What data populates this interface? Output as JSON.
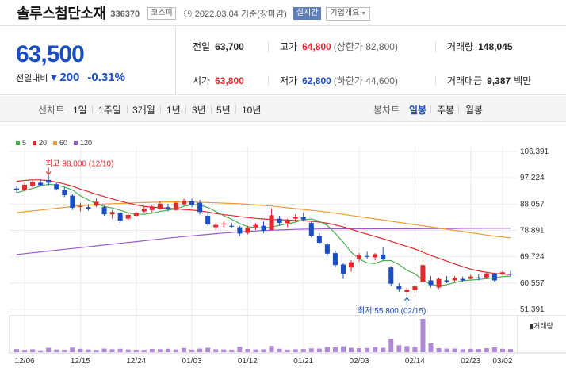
{
  "header": {
    "name": "솔루스첨단소재",
    "code": "336370",
    "market": "코스피",
    "date": "2022.03.04 기준(장마감)",
    "live": "실시간",
    "corp": "기업개요"
  },
  "price": {
    "current": "63,500",
    "change_label": "전일대비",
    "change_amount": "200",
    "change_pct": "-0.31%",
    "direction_symbol": "▼"
  },
  "quote": {
    "prev": {
      "k": "전일",
      "v": "63,700"
    },
    "high": {
      "k": "고가",
      "v": "64,800",
      "s": "(상한가 82,800)"
    },
    "volume": {
      "k": "거래량",
      "v": "148,045"
    },
    "open": {
      "k": "시가",
      "v": "63,800"
    },
    "low": {
      "k": "저가",
      "v": "62,800",
      "s": "(하한가 44,600)"
    },
    "amount": {
      "k": "거래대금",
      "v": "9,387",
      "unit": "백만"
    }
  },
  "periods": {
    "label": "선차트",
    "items": [
      "1일",
      "1주일",
      "3개월",
      "1년",
      "3년",
      "5년",
      "10년"
    ],
    "candle_label": "봉차트",
    "candle_items": [
      "일봉",
      "주봉",
      "월봉"
    ],
    "selected": "일봉"
  },
  "colors": {
    "up": "#e0282d",
    "down": "#1a4ec4",
    "ma5": "#4caf50",
    "ma20": "#e0282d",
    "ma60": "#f29a2e",
    "ma120": "#9b59d0"
  },
  "chart_data": {
    "type": "candlestick",
    "legend": [
      {
        "name": "5",
        "color": "#4caf50"
      },
      {
        "name": "20",
        "color": "#e0282d"
      },
      {
        "name": "60",
        "color": "#f29a2e"
      },
      {
        "name": "120",
        "color": "#9b59d0"
      }
    ],
    "y_ticks": [
      "106,391",
      "97,224",
      "88,057",
      "78,891",
      "69,724",
      "60,557",
      "51,391"
    ],
    "ylim": [
      51391,
      106391
    ],
    "x_ticks": [
      "12/06",
      "12/15",
      "12/24",
      "01/03",
      "01/12",
      "01/21",
      "02/03",
      "02/14",
      "02/23",
      "03/02"
    ],
    "x_tick_index": [
      1,
      8,
      15,
      22,
      29,
      36,
      43,
      50,
      57,
      61
    ],
    "max_label": "최고 98,000 (12/10)",
    "min_label": "최저 55,800 (02/15)",
    "volume_label": "거래량",
    "candles": [
      [
        93500,
        94500,
        92000,
        93000
      ],
      [
        93000,
        95500,
        92500,
        94800
      ],
      [
        94500,
        96500,
        93800,
        95800
      ],
      [
        95500,
        96800,
        94200,
        94600
      ],
      [
        96500,
        98000,
        94500,
        95500
      ],
      [
        95000,
        95500,
        92800,
        93300
      ],
      [
        93000,
        94000,
        90500,
        91200
      ],
      [
        91000,
        91500,
        86000,
        86800
      ],
      [
        87000,
        88500,
        85500,
        87300
      ],
      [
        87000,
        88000,
        85800,
        86500
      ],
      [
        87500,
        90000,
        87000,
        88900
      ],
      [
        87000,
        87500,
        84000,
        84500
      ],
      [
        84500,
        86000,
        83000,
        85300
      ],
      [
        85000,
        85500,
        81500,
        82300
      ],
      [
        83000,
        85000,
        82500,
        84300
      ],
      [
        84000,
        85500,
        83500,
        85000
      ],
      [
        85500,
        87500,
        85000,
        86500
      ],
      [
        86000,
        87800,
        85000,
        87200
      ],
      [
        86500,
        89000,
        86000,
        88200
      ],
      [
        87000,
        88200,
        85500,
        86500
      ],
      [
        86000,
        88800,
        85800,
        88500
      ],
      [
        88000,
        90000,
        87500,
        89300
      ],
      [
        89000,
        90000,
        87000,
        87800
      ],
      [
        88500,
        89500,
        84500,
        85300
      ],
      [
        84000,
        85000,
        80500,
        81000
      ],
      [
        80000,
        81500,
        79000,
        80800
      ],
      [
        81000,
        82000,
        80000,
        81300
      ],
      [
        80500,
        81500,
        79800,
        80200
      ],
      [
        80000,
        80500,
        77000,
        77800
      ],
      [
        78000,
        80500,
        77500,
        79900
      ],
      [
        80000,
        81500,
        79000,
        80800
      ],
      [
        80500,
        82000,
        78000,
        78800
      ],
      [
        79000,
        86500,
        79000,
        84200
      ],
      [
        83000,
        84000,
        80500,
        81500
      ],
      [
        81500,
        83000,
        80000,
        82600
      ],
      [
        83000,
        84500,
        82000,
        83500
      ],
      [
        83500,
        85000,
        82000,
        82700
      ],
      [
        81500,
        82000,
        76500,
        77000
      ],
      [
        77000,
        78000,
        74000,
        74600
      ],
      [
        74000,
        74500,
        70000,
        70800
      ],
      [
        71000,
        72000,
        66000,
        66800
      ],
      [
        67000,
        67500,
        62000,
        63800
      ],
      [
        66000,
        68500,
        64500,
        67800
      ],
      [
        69000,
        71000,
        68000,
        70200
      ],
      [
        70000,
        71500,
        69000,
        69700
      ],
      [
        69500,
        71000,
        68500,
        70600
      ],
      [
        70500,
        73000,
        68500,
        68800
      ],
      [
        66000,
        66500,
        59500,
        60300
      ],
      [
        59500,
        60500,
        57500,
        58500
      ],
      [
        57500,
        59000,
        55800,
        58300
      ],
      [
        58000,
        60000,
        57000,
        59500
      ],
      [
        61000,
        73500,
        60500,
        66800
      ],
      [
        61500,
        63000,
        59000,
        59800
      ],
      [
        59000,
        62500,
        58500,
        62000
      ],
      [
        61500,
        63000,
        60500,
        61000
      ],
      [
        61500,
        63000,
        60800,
        62400
      ],
      [
        62000,
        62800,
        61000,
        61500
      ],
      [
        62000,
        63500,
        61800,
        62800
      ],
      [
        62500,
        63500,
        61500,
        62300
      ],
      [
        62500,
        64500,
        62000,
        63900
      ],
      [
        63800,
        64200,
        61000,
        61500
      ],
      [
        63600,
        64800,
        63200,
        64300
      ],
      [
        63800,
        64800,
        62800,
        63500
      ]
    ],
    "ma5": [
      92000,
      92800,
      93500,
      94300,
      95000,
      94700,
      94000,
      93000,
      91000,
      89500,
      88200,
      87200,
      86700,
      85900,
      85000,
      84600,
      84500,
      84900,
      85500,
      86000,
      86400,
      87300,
      87900,
      87700,
      86900,
      85500,
      84000,
      82800,
      81300,
      80200,
      79800,
      79800,
      80000,
      80700,
      81200,
      81800,
      82600,
      82900,
      82100,
      80600,
      77900,
      74800,
      71300,
      69000,
      67600,
      67400,
      68400,
      68400,
      67000,
      65000,
      63800,
      61600,
      60100,
      59600,
      60000,
      60700,
      61400,
      61600,
      61800,
      62100,
      62400,
      62800,
      63000
    ],
    "ma20": [
      96000,
      96300,
      96500,
      96500,
      96200,
      95700,
      95100,
      94300,
      93300,
      92400,
      91500,
      90700,
      89900,
      89100,
      88400,
      87800,
      87300,
      87000,
      86800,
      86600,
      86400,
      86200,
      86000,
      85700,
      85300,
      84800,
      84400,
      84100,
      83700,
      83400,
      83100,
      82900,
      82700,
      82600,
      82500,
      82400,
      82300,
      82100,
      81800,
      81400,
      80800,
      80100,
      79300,
      78400,
      77600,
      76800,
      76000,
      75100,
      74200,
      73300,
      72400,
      71300,
      70200,
      69200,
      68200,
      67200,
      66300,
      65400,
      64800,
      64300,
      63900,
      63700,
      63500
    ],
    "ma60": [
      85000,
      85400,
      85700,
      86000,
      86300,
      86600,
      86900,
      87200,
      87500,
      87700,
      87900,
      88100,
      88200,
      88300,
      88400,
      88500,
      88600,
      88700,
      88750,
      88800,
      88800,
      88800,
      88750,
      88700,
      88600,
      88500,
      88400,
      88300,
      88200,
      88000,
      87800,
      87600,
      87400,
      87100,
      86800,
      86500,
      86200,
      85900,
      85600,
      85300,
      84900,
      84500,
      84100,
      83700,
      83300,
      82900,
      82500,
      82100,
      81700,
      81300,
      80900,
      80500,
      80100,
      79700,
      79300,
      78900,
      78500,
      78100,
      77700,
      77300,
      76900,
      76600,
      76300
    ],
    "ma120": [
      70500,
      70800,
      71100,
      71400,
      71700,
      72000,
      72300,
      72600,
      72900,
      73200,
      73500,
      73800,
      74100,
      74400,
      74700,
      75000,
      75300,
      75600,
      75900,
      76200,
      76500,
      76750,
      77000,
      77250,
      77500,
      77750,
      78000,
      78200,
      78400,
      78550,
      78700,
      78850,
      78950,
      79050,
      79150,
      79250,
      79300,
      79350,
      79400,
      79450,
      79450,
      79450,
      79450,
      79450,
      79450,
      79450,
      79450,
      79450,
      79450,
      79450,
      79450,
      79500,
      79500,
      79550,
      79550,
      79550,
      79600,
      79600,
      79600,
      79650,
      79650,
      79650,
      79650
    ],
    "volumes": [
      150,
      110,
      140,
      90,
      210,
      130,
      120,
      220,
      160,
      130,
      110,
      170,
      140,
      160,
      130,
      120,
      110,
      150,
      140,
      160,
      130,
      200,
      120,
      170,
      210,
      140,
      130,
      120,
      260,
      150,
      130,
      140,
      300,
      160,
      120,
      140,
      150,
      180,
      170,
      250,
      230,
      280,
      210,
      190,
      200,
      240,
      210,
      640,
      330,
      290,
      250,
      1600,
      420,
      190,
      170,
      170,
      140,
      160,
      150,
      190,
      230,
      160,
      150
    ]
  }
}
